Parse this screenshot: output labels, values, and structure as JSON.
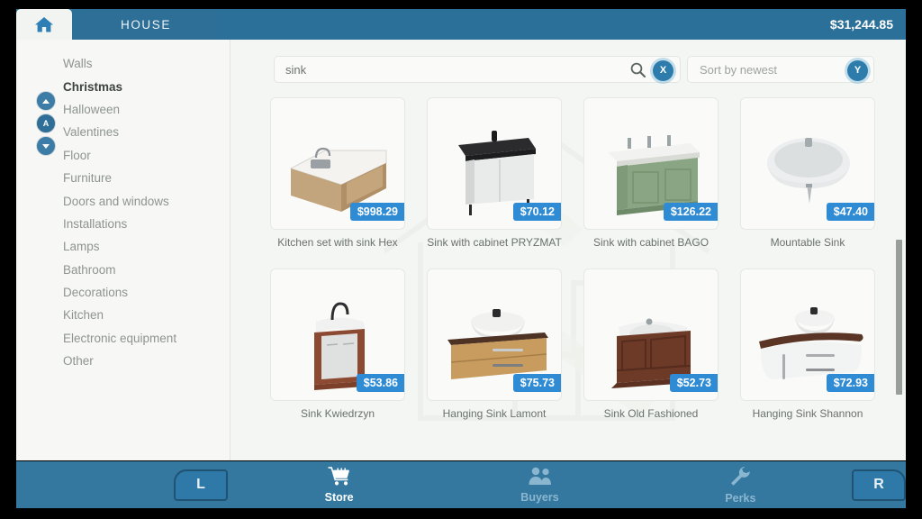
{
  "topbar": {
    "home_icon": "home-icon",
    "tab_label": "HOUSE",
    "money": "$31,244.85"
  },
  "sidebar": {
    "buttons": {
      "up": "up-arrow",
      "a": "A",
      "down": "down-arrow"
    },
    "items": [
      {
        "label": "Walls",
        "selected": false
      },
      {
        "label": "Christmas",
        "selected": true
      },
      {
        "label": "Halloween",
        "selected": false
      },
      {
        "label": "Valentines",
        "selected": false
      },
      {
        "label": "Floor",
        "selected": false
      },
      {
        "label": "Furniture",
        "selected": false
      },
      {
        "label": "Doors and windows",
        "selected": false
      },
      {
        "label": "Installations",
        "selected": false
      },
      {
        "label": "Lamps",
        "selected": false
      },
      {
        "label": "Bathroom",
        "selected": false
      },
      {
        "label": "Decorations",
        "selected": false
      },
      {
        "label": "Kitchen",
        "selected": false
      },
      {
        "label": "Electronic equipment",
        "selected": false
      },
      {
        "label": "Other",
        "selected": false
      }
    ]
  },
  "search": {
    "value": "sink",
    "placeholder": "Search",
    "search_icon": "search-icon",
    "clear_button_label": "X",
    "sort_value": "Sort by newest",
    "sort_button_label": "Y"
  },
  "products": [
    {
      "name": "Kitchen set with sink Hex",
      "price": "$998.29",
      "thumb": "kitchen-set-corner-counter"
    },
    {
      "name": "Sink with cabinet PRYZMAT",
      "price": "$70.12",
      "thumb": "white-cabinet-black-top-sink"
    },
    {
      "name": "Sink with cabinet BAGO",
      "price": "$126.22",
      "thumb": "green-cabinet-double-tap-sink"
    },
    {
      "name": "Mountable Sink",
      "price": "$47.40",
      "thumb": "white-wall-mounted-basin"
    },
    {
      "name": "Sink Kwiedrzyn",
      "price": "$53.86",
      "thumb": "narrow-wood-cabinet-sink"
    },
    {
      "name": "Hanging Sink Lamont",
      "price": "$75.73",
      "thumb": "oak-hanging-vanity-vessel-sink"
    },
    {
      "name": "Sink Old Fashioned",
      "price": "$52.73",
      "thumb": "dark-wood-classic-vanity"
    },
    {
      "name": "Hanging Sink Shannon",
      "price": "$72.93",
      "thumb": "white-curved-hanging-vanity"
    }
  ],
  "bottombar": {
    "left_shoulder": "L",
    "right_shoulder": "R",
    "nav": [
      {
        "label": "Store",
        "icon": "shopping-cart-icon",
        "active": true
      },
      {
        "label": "Buyers",
        "icon": "people-icon",
        "active": false
      },
      {
        "label": "Perks",
        "icon": "wrench-icon",
        "active": false
      }
    ]
  },
  "colors": {
    "accent_blue": "#2f8bd4",
    "bar_blue": "#2b7099",
    "panel_bg": "#f4f6f3"
  }
}
